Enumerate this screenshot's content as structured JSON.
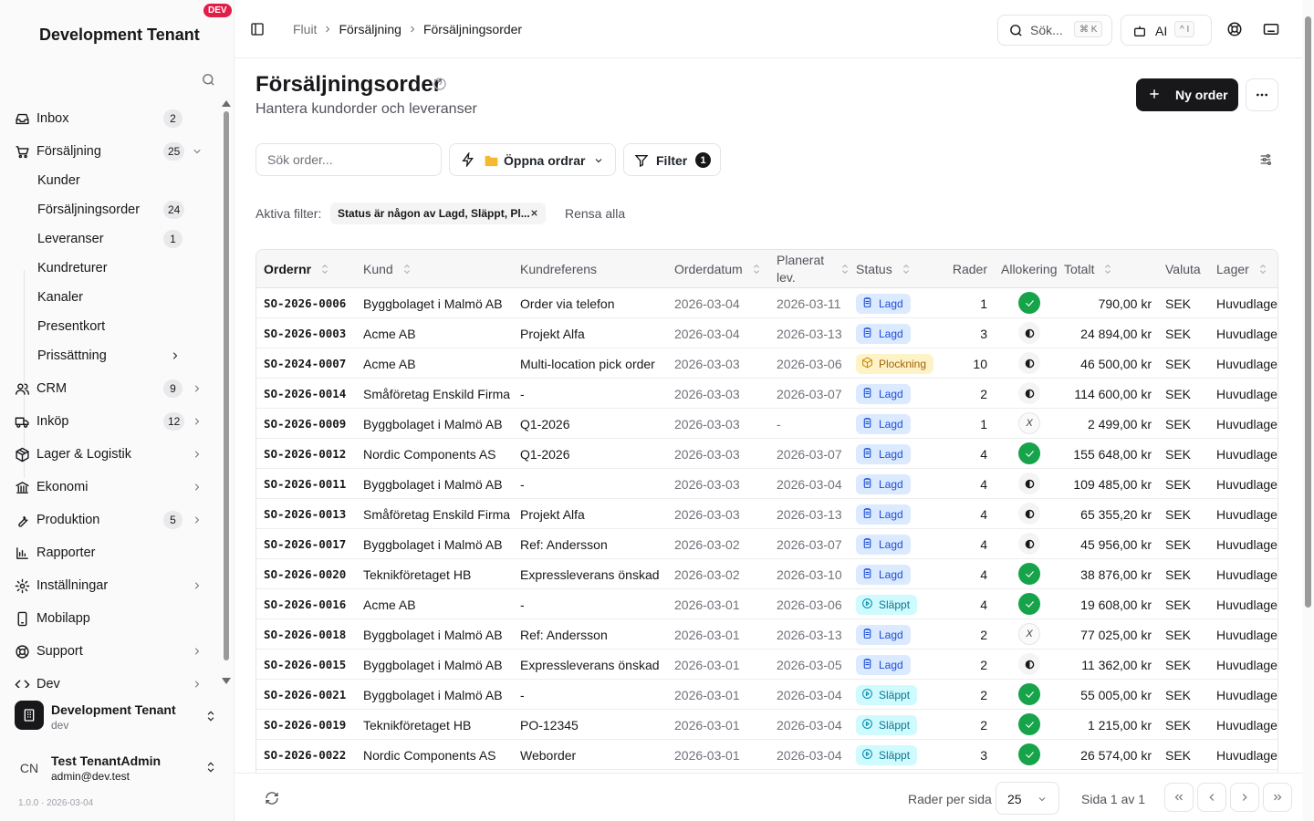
{
  "sidebar": {
    "tenant_title": "Development Tenant",
    "env_badge": "DEV",
    "items": [
      {
        "label": "Inbox",
        "count": "2",
        "icon": "inbox-icon",
        "chevron": false
      },
      {
        "label": "Försäljning",
        "count": "25",
        "icon": "cart-icon",
        "chevron": "down"
      },
      {
        "label": "Kunder",
        "sub": true
      },
      {
        "label": "Försäljningsorder",
        "count": "24",
        "sub": true
      },
      {
        "label": "Leveranser",
        "count": "1",
        "sub": true
      },
      {
        "label": "Kundreturer",
        "sub": true
      },
      {
        "label": "Kanaler",
        "sub": true
      },
      {
        "label": "Presentkort",
        "sub": true
      },
      {
        "label": "Prissättning",
        "sub": true,
        "chevron": "right"
      },
      {
        "label": "CRM",
        "count": "9",
        "icon": "users-icon",
        "chevron": "right"
      },
      {
        "label": "Inköp",
        "count": "12",
        "icon": "truck-icon",
        "chevron": "right"
      },
      {
        "label": "Lager & Logistik",
        "icon": "package-icon",
        "chevron": "right"
      },
      {
        "label": "Ekonomi",
        "icon": "bank-icon",
        "chevron": "right"
      },
      {
        "label": "Produktion",
        "count": "5",
        "icon": "wrench-icon",
        "chevron": "right"
      },
      {
        "label": "Rapporter",
        "icon": "bar-chart-icon"
      },
      {
        "label": "Inställningar",
        "icon": "settings-icon",
        "chevron": "right"
      },
      {
        "label": "Mobilapp",
        "icon": "phone-icon"
      },
      {
        "label": "Support",
        "icon": "lifebuoy-icon",
        "chevron": "right"
      },
      {
        "label": "Dev",
        "icon": "code-icon",
        "chevron": "right"
      }
    ],
    "tenant_switch": {
      "name": "Development Tenant",
      "sub": "dev"
    },
    "user": {
      "initials": "CN",
      "name": "Test TenantAdmin",
      "email": "admin@dev.test"
    },
    "version": "1.0.0 · 2026-03-04"
  },
  "header": {
    "breadcrumbs": [
      "Fluit",
      "Försäljning",
      "Försäljningsorder"
    ],
    "search_label": "Sök...",
    "search_kbd": "⌘ K",
    "ai_label": "AI",
    "ai_kbd": "^ I"
  },
  "page": {
    "title": "Försäljningsorder",
    "subtitle": "Hantera kundorder och leveranser",
    "new_order": "Ny order",
    "search_placeholder": "Sök order...",
    "view_label": "Öppna ordrar",
    "filter_label": "Filter",
    "filter_count": "1",
    "active_filters_label": "Aktiva filter:",
    "active_filter_chip": "Status är någon av Lagd, Släppt, Pl...",
    "clear_all": "Rensa alla"
  },
  "table": {
    "columns": [
      "Ordernr",
      "Kund",
      "Kundreferens",
      "Orderdatum",
      "Planerat lev.",
      "Status",
      "Rader",
      "Allokering",
      "Totalt",
      "Valuta",
      "Lager"
    ],
    "rows": [
      [
        "SO-2026-0006",
        "Byggbolaget i Malmö AB",
        "Order via telefon",
        "2026-03-04",
        "2026-03-11",
        "Lagd",
        "1",
        "full",
        "790,00 kr",
        "SEK",
        "Huvudlage"
      ],
      [
        "SO-2026-0003",
        "Acme AB",
        "Projekt Alfa",
        "2026-03-04",
        "2026-03-13",
        "Lagd",
        "3",
        "part",
        "24 894,00 kr",
        "SEK",
        "Huvudlage"
      ],
      [
        "SO-2024-0007",
        "Acme AB",
        "Multi-location pick order",
        "2026-03-03",
        "2026-03-06",
        "Plockning",
        "10",
        "part",
        "46 500,00 kr",
        "SEK",
        "Huvudlage"
      ],
      [
        "SO-2026-0014",
        "Småföretag Enskild Firma",
        "-",
        "2026-03-03",
        "2026-03-07",
        "Lagd",
        "2",
        "part",
        "114 600,00 kr",
        "SEK",
        "Huvudlage"
      ],
      [
        "SO-2026-0009",
        "Byggbolaget i Malmö AB",
        "Q1-2026",
        "2026-03-03",
        "-",
        "Lagd",
        "1",
        "none",
        "2 499,00 kr",
        "SEK",
        "Huvudlage"
      ],
      [
        "SO-2026-0012",
        "Nordic Components AS",
        "Q1-2026",
        "2026-03-03",
        "2026-03-07",
        "Lagd",
        "4",
        "full",
        "155 648,00 kr",
        "SEK",
        "Huvudlage"
      ],
      [
        "SO-2026-0011",
        "Byggbolaget i Malmö AB",
        "-",
        "2026-03-03",
        "2026-03-04",
        "Lagd",
        "4",
        "part",
        "109 485,00 kr",
        "SEK",
        "Huvudlage"
      ],
      [
        "SO-2026-0013",
        "Småföretag Enskild Firma",
        "Projekt Alfa",
        "2026-03-03",
        "2026-03-13",
        "Lagd",
        "4",
        "part",
        "65 355,20 kr",
        "SEK",
        "Huvudlage"
      ],
      [
        "SO-2026-0017",
        "Byggbolaget i Malmö AB",
        "Ref: Andersson",
        "2026-03-02",
        "2026-03-07",
        "Lagd",
        "4",
        "part",
        "45 956,00 kr",
        "SEK",
        "Huvudlage"
      ],
      [
        "SO-2026-0020",
        "Teknikföretaget HB",
        "Expressleverans önskad",
        "2026-03-02",
        "2026-03-10",
        "Lagd",
        "4",
        "full",
        "38 876,00 kr",
        "SEK",
        "Huvudlage"
      ],
      [
        "SO-2026-0016",
        "Acme AB",
        "-",
        "2026-03-01",
        "2026-03-06",
        "Släppt",
        "4",
        "full",
        "19 608,00 kr",
        "SEK",
        "Huvudlage"
      ],
      [
        "SO-2026-0018",
        "Byggbolaget i Malmö AB",
        "Ref: Andersson",
        "2026-03-01",
        "2026-03-13",
        "Lagd",
        "2",
        "none",
        "77 025,00 kr",
        "SEK",
        "Huvudlage"
      ],
      [
        "SO-2026-0015",
        "Byggbolaget i Malmö AB",
        "Expressleverans önskad",
        "2026-03-01",
        "2026-03-05",
        "Lagd",
        "2",
        "part",
        "11 362,00 kr",
        "SEK",
        "Huvudlage"
      ],
      [
        "SO-2026-0021",
        "Byggbolaget i Malmö AB",
        "-",
        "2026-03-01",
        "2026-03-04",
        "Släppt",
        "2",
        "full",
        "55 005,00 kr",
        "SEK",
        "Huvudlage"
      ],
      [
        "SO-2026-0019",
        "Teknikföretaget HB",
        "PO-12345",
        "2026-03-01",
        "2026-03-04",
        "Släppt",
        "2",
        "full",
        "1 215,00 kr",
        "SEK",
        "Huvudlage"
      ],
      [
        "SO-2026-0022",
        "Nordic Components AS",
        "Weborder",
        "2026-03-01",
        "2026-03-04",
        "Släppt",
        "3",
        "full",
        "26 574,00 kr",
        "SEK",
        "Huvudlage"
      ]
    ]
  },
  "footer": {
    "rows_per_page_label": "Rader per sida",
    "rows_per_page": "25",
    "page_info": "Sida 1 av 1"
  },
  "colors": {
    "accent": "#18181b",
    "lagd": "#dbeafe",
    "slappt": "#cffafe",
    "plockning": "#fef3c7",
    "allocated": "#16a34a",
    "dev_badge": "#e11d48"
  }
}
